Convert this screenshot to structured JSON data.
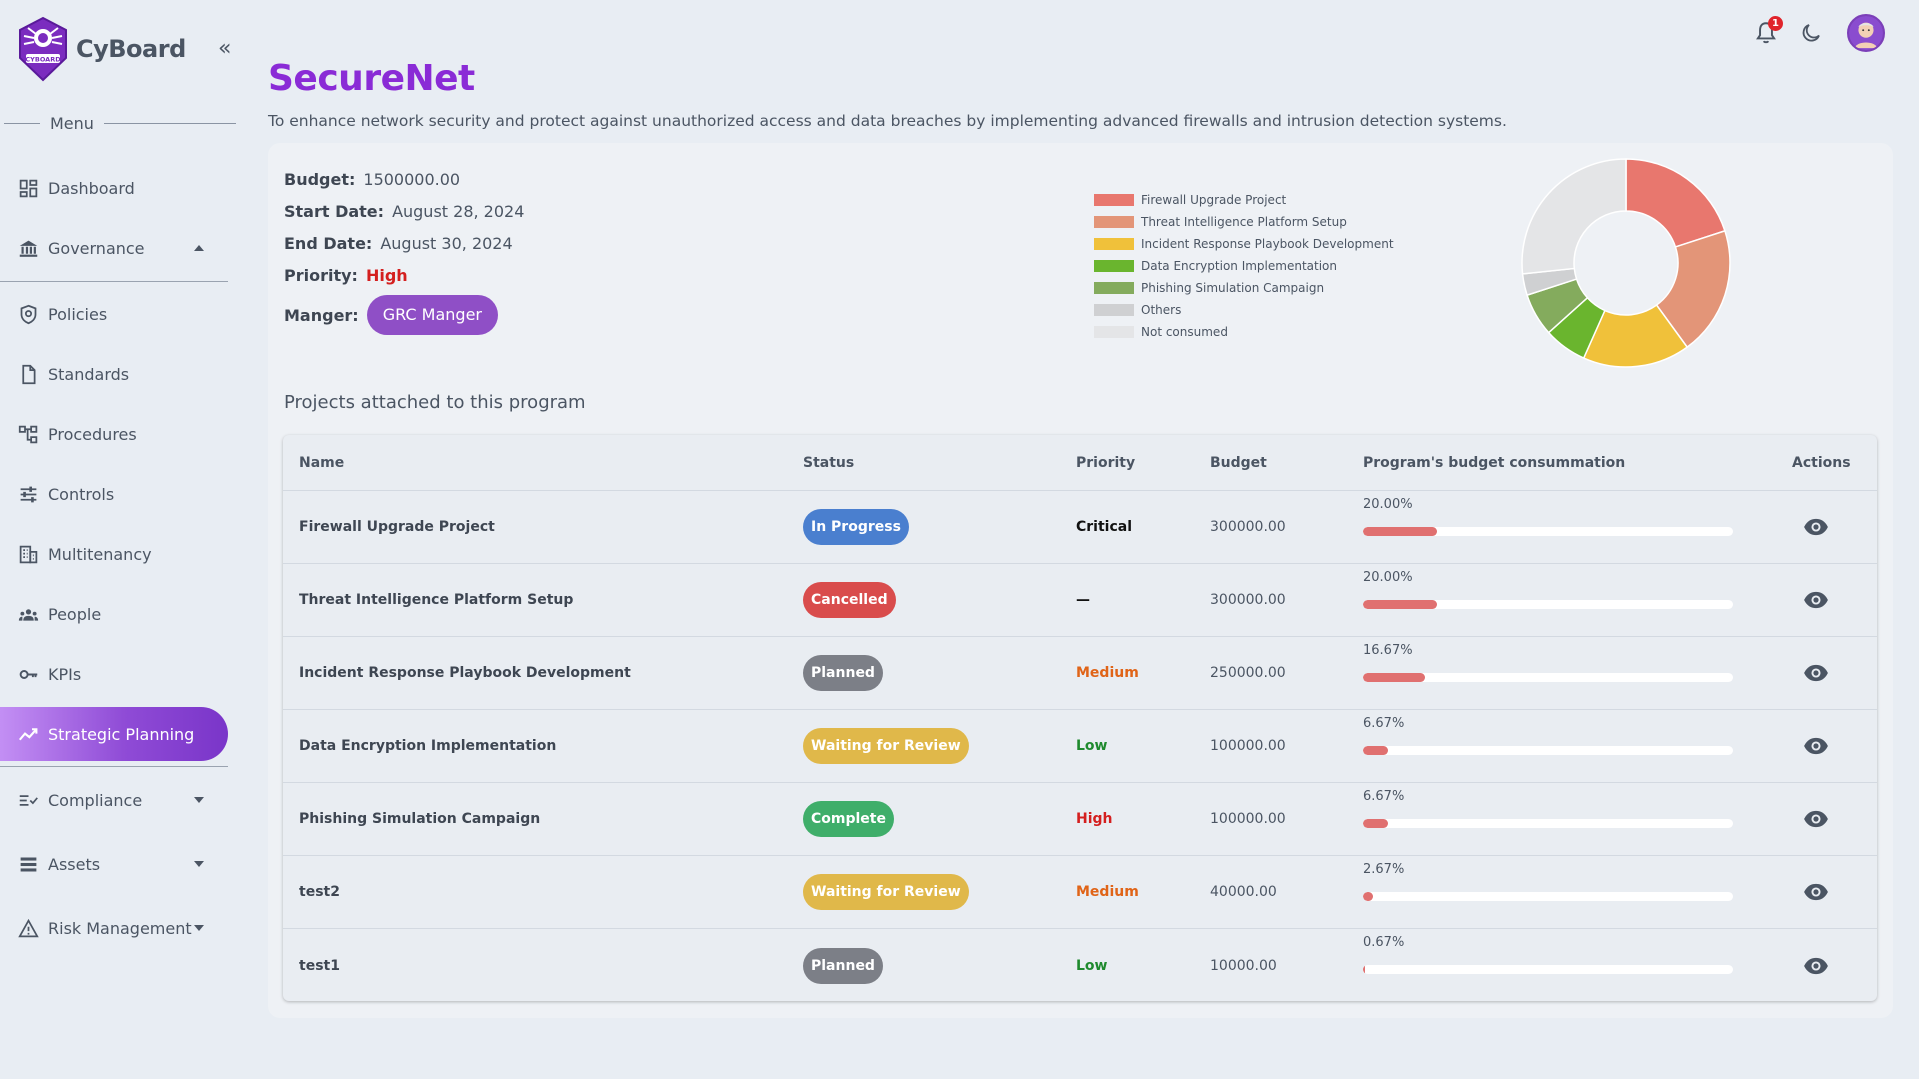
{
  "brand": {
    "name": "CyBoard",
    "logo_text": "CYBOARD"
  },
  "sidebar": {
    "menu_label": "Menu",
    "items": [
      {
        "label": "Dashboard",
        "icon": "dashboard-icon"
      },
      {
        "label": "Governance",
        "icon": "bank-icon",
        "expanded": true
      },
      {
        "label": "Policies",
        "icon": "shield-icon"
      },
      {
        "label": "Standards",
        "icon": "document-icon"
      },
      {
        "label": "Procedures",
        "icon": "flowchart-icon"
      },
      {
        "label": "Controls",
        "icon": "sliders-icon"
      },
      {
        "label": "Multitenancy",
        "icon": "building-icon"
      },
      {
        "label": "People",
        "icon": "people-icon"
      },
      {
        "label": "KPIs",
        "icon": "key-icon"
      },
      {
        "label": "Strategic Planning",
        "icon": "trend-icon",
        "active": true
      },
      {
        "label": "Compliance",
        "icon": "checklist-icon"
      },
      {
        "label": "Assets",
        "icon": "list-icon"
      },
      {
        "label": "Risk Management",
        "icon": "warning-icon"
      }
    ]
  },
  "header": {
    "notification_count": "1"
  },
  "program": {
    "title": "SecureNet",
    "description": "To enhance network security and protect against unauthorized access and data breaches by implementing advanced firewalls and intrusion detection systems.",
    "budget_label": "Budget:",
    "budget": "1500000.00",
    "start_label": "Start Date:",
    "start": "August 28, 2024",
    "end_label": "End Date:",
    "end": "August 30, 2024",
    "priority_label": "Priority:",
    "priority": "High",
    "manager_label": "Manger:",
    "manager": "GRC Manger"
  },
  "chart_data": {
    "type": "pie",
    "categories": [
      "Firewall Upgrade Project",
      "Threat Intelligence Platform Setup",
      "Incident Response Playbook Development",
      "Data Encryption Implementation",
      "Phishing Simulation Campaign",
      "Others",
      "Not consumed"
    ],
    "values": [
      20.0,
      20.0,
      16.67,
      6.67,
      6.67,
      3.33,
      26.67
    ],
    "colors": [
      "#e8776e",
      "#e39578",
      "#f0c13a",
      "#6ab52e",
      "#84ab5d",
      "#cfd0d2",
      "#e4e5e7"
    ],
    "legend": "left"
  },
  "projects": {
    "section_title": "Projects attached to this program",
    "headers": {
      "name": "Name",
      "status": "Status",
      "priority": "Priority",
      "budget": "Budget",
      "consumption": "Program's budget consummation",
      "actions": "Actions"
    },
    "rows": [
      {
        "name": "Firewall Upgrade Project",
        "status": "In Progress",
        "status_class": "st-progress",
        "priority": "Critical",
        "priority_class": "prio-critical",
        "budget": "300000.00",
        "pct": "20.00%",
        "fraction": 0.2
      },
      {
        "name": "Threat Intelligence Platform Setup",
        "status": "Cancelled",
        "status_class": "st-cancelled",
        "priority": "—",
        "priority_class": "prio-none",
        "budget": "300000.00",
        "pct": "20.00%",
        "fraction": 0.2
      },
      {
        "name": "Incident Response Playbook Development",
        "status": "Planned",
        "status_class": "st-planned",
        "priority": "Medium",
        "priority_class": "prio-medium",
        "budget": "250000.00",
        "pct": "16.67%",
        "fraction": 0.1667
      },
      {
        "name": "Data Encryption Implementation",
        "status": "Waiting for Review",
        "status_class": "st-waiting",
        "priority": "Low",
        "priority_class": "prio-low",
        "budget": "100000.00",
        "pct": "6.67%",
        "fraction": 0.0667
      },
      {
        "name": "Phishing Simulation Campaign",
        "status": "Complete",
        "status_class": "st-complete",
        "priority": "High",
        "priority_class": "prio-high",
        "budget": "100000.00",
        "pct": "6.67%",
        "fraction": 0.0667
      },
      {
        "name": "test2",
        "status": "Waiting for Review",
        "status_class": "st-waiting",
        "priority": "Medium",
        "priority_class": "prio-medium",
        "budget": "40000.00",
        "pct": "2.67%",
        "fraction": 0.0267
      },
      {
        "name": "test1",
        "status": "Planned",
        "status_class": "st-planned",
        "priority": "Low",
        "priority_class": "prio-low",
        "budget": "10000.00",
        "pct": "0.67%",
        "fraction": 0.0067
      }
    ]
  }
}
